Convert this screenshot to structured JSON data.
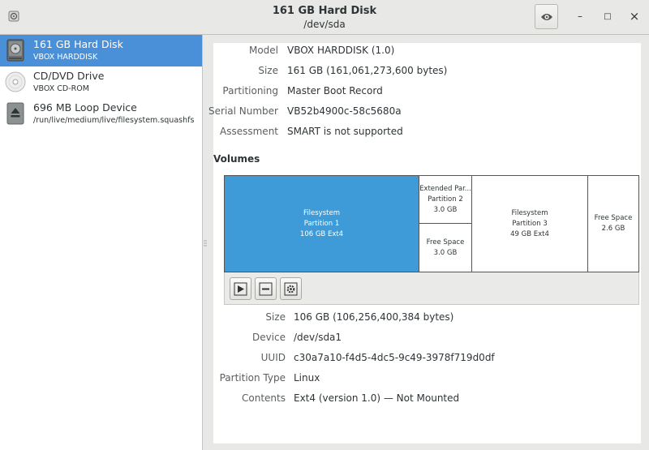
{
  "header": {
    "title": "161 GB Hard Disk",
    "subtitle": "/dev/sda",
    "minimize_label": "–",
    "maximize_label": "□",
    "close_label": "×"
  },
  "sidebar": {
    "items": [
      {
        "name": "161 GB Hard Disk",
        "sub": "VBOX HARDDISK",
        "icon": "harddisk-icon",
        "selected": true
      },
      {
        "name": "CD/DVD Drive",
        "sub": "VBOX CD-ROM",
        "icon": "optical-disc-icon",
        "selected": false
      },
      {
        "name": "696 MB Loop Device",
        "sub": "/run/live/medium/live/filesystem.squashfs",
        "icon": "loop-device-icon",
        "selected": false
      }
    ]
  },
  "drive": {
    "model_label": "Model",
    "model": "VBOX HARDDISK (1.0)",
    "size_label": "Size",
    "size": "161 GB (161,061,273,600 bytes)",
    "partitioning_label": "Partitioning",
    "partitioning": "Master Boot Record",
    "serial_label": "Serial Number",
    "serial": "VB52b4900c-58c5680a",
    "assessment_label": "Assessment",
    "assessment": "SMART is not supported"
  },
  "volumes": {
    "heading": "Volumes",
    "segments": {
      "p1": {
        "l1": "Filesystem",
        "l2": "Partition 1",
        "l3": "106 GB Ext4"
      },
      "p2": {
        "l1": "Extended Par...",
        "l2": "Partition 2",
        "l3": "3.0 GB"
      },
      "free_inner": {
        "l1": "Free Space",
        "l2": "3.0 GB"
      },
      "p3": {
        "l1": "Filesystem",
        "l2": "Partition 3",
        "l3": "49 GB Ext4"
      },
      "free_end": {
        "l1": "Free Space",
        "l2": "2.6 GB"
      }
    },
    "toolbar_icons": [
      "play-icon",
      "minus-icon",
      "gear-icon"
    ]
  },
  "partition": {
    "size_label": "Size",
    "size": "106 GB (106,256,400,384 bytes)",
    "device_label": "Device",
    "device": "/dev/sda1",
    "uuid_label": "UUID",
    "uuid": "c30a7a10-f4d5-4dc5-9c49-3978f719d0df",
    "type_label": "Partition Type",
    "type": "Linux",
    "contents_label": "Contents",
    "contents": "Ext4 (version 1.0) — Not Mounted"
  },
  "colors": {
    "accent": "#4a90d9",
    "selected_segment": "#3e9bd7"
  }
}
